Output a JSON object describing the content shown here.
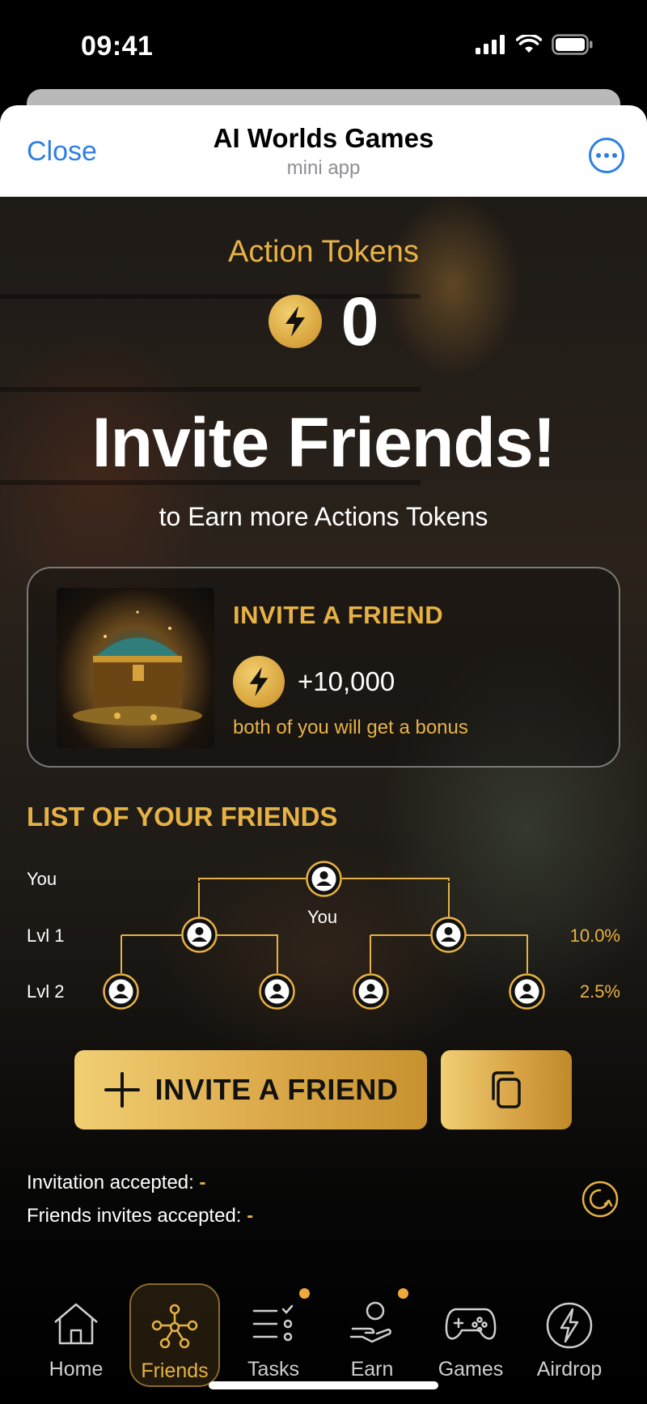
{
  "status_bar": {
    "time": "09:41"
  },
  "header": {
    "close_label": "Close",
    "title": "AI Worlds Games",
    "subtitle": "mini app"
  },
  "tokens": {
    "label": "Action Tokens",
    "value": "0"
  },
  "hero": {
    "title": "Invite Friends!",
    "subtitle": "to Earn more Actions Tokens"
  },
  "invite_card": {
    "title": "INVITE A FRIEND",
    "reward": "+10,000",
    "note": "both of you will get a bonus"
  },
  "friends": {
    "title": "LIST OF YOUR FRIENDS",
    "levels": [
      {
        "label": "You",
        "percent": ""
      },
      {
        "label": "Lvl 1",
        "percent": "10.0%"
      },
      {
        "label": "Lvl 2",
        "percent": "2.5%"
      }
    ],
    "you_node_label": "You"
  },
  "actions": {
    "invite_label": "INVITE A FRIEND"
  },
  "stats": {
    "invitation_label": "Invitation accepted:",
    "invitation_value": "-",
    "friends_label": "Friends invites accepted:",
    "friends_value": "-"
  },
  "tabs": [
    {
      "label": "Home",
      "icon": "home-icon",
      "active": false
    },
    {
      "label": "Friends",
      "icon": "network-icon",
      "active": true
    },
    {
      "label": "Tasks",
      "icon": "tasks-icon",
      "badge": true
    },
    {
      "label": "Earn",
      "icon": "earn-icon",
      "badge": true
    },
    {
      "label": "Games",
      "icon": "gamepad-icon"
    },
    {
      "label": "Airdrop",
      "icon": "lightning-icon"
    }
  ],
  "colors": {
    "accent": "#e7b245",
    "link": "#2f7fe3",
    "badge": "#f0a93b"
  }
}
